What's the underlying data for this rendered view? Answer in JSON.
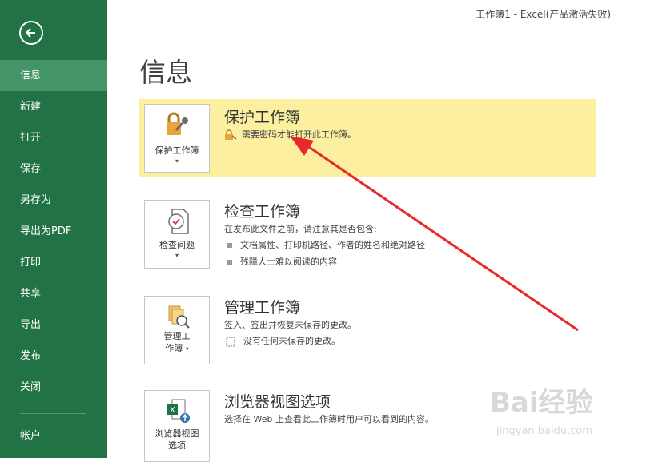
{
  "window_title": "工作簿1 - Excel(产品激活失败)",
  "page_title": "信息",
  "sidebar": {
    "items": [
      {
        "label": "信息"
      },
      {
        "label": "新建"
      },
      {
        "label": "打开"
      },
      {
        "label": "保存"
      },
      {
        "label": "另存为"
      },
      {
        "label": "导出为PDF"
      },
      {
        "label": "打印"
      },
      {
        "label": "共享"
      },
      {
        "label": "导出"
      },
      {
        "label": "发布"
      },
      {
        "label": "关闭"
      },
      {
        "label": "帐户"
      }
    ]
  },
  "protect": {
    "button_label": "保护工作簿",
    "title": "保护工作簿",
    "description": "需要密码才能打开此工作簿。"
  },
  "inspect": {
    "button_label": "检查问题",
    "title": "检查工作簿",
    "description": "在发布此文件之前，请注意其是否包含:",
    "bullets": [
      "文档属性、打印机路径、作者的姓名和绝对路径",
      "残障人士难以阅读的内容"
    ]
  },
  "manage": {
    "button_label_line1": "管理工",
    "button_label_line2": "作簿",
    "title": "管理工作簿",
    "description": "签入、签出并恢复未保存的更改。",
    "note": "没有任何未保存的更改。"
  },
  "browser": {
    "button_label_line1": "浏览器视图",
    "button_label_line2": "选项",
    "title": "浏览器视图选项",
    "description": "选择在 Web 上查看此工作簿时用户可以看到的内容。"
  },
  "watermark": {
    "main": "Bai经验",
    "sub": "jingyan.baidu.com"
  },
  "colors": {
    "sidebar": "#217346",
    "active": "#439467",
    "highlight": "#fcf0a0",
    "arrow": "#e8282a"
  }
}
